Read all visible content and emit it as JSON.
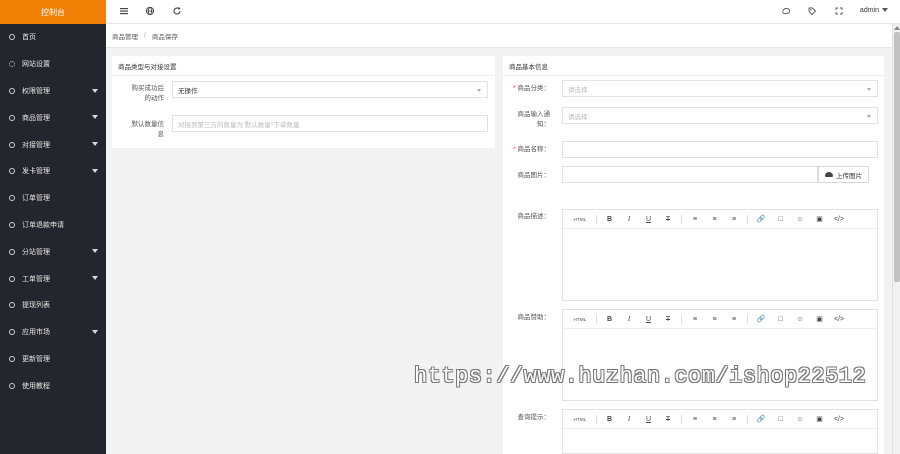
{
  "app": {
    "brand": "控制台",
    "admin": "admin"
  },
  "sidebar": {
    "items": [
      {
        "label": "首页",
        "icon": "circle-icon",
        "expandable": false
      },
      {
        "label": "网站设置",
        "icon": "gear-icon",
        "expandable": false
      },
      {
        "label": "权限管理",
        "icon": "circle-icon",
        "expandable": true
      },
      {
        "label": "商品管理",
        "icon": "circle-icon",
        "expandable": true
      },
      {
        "label": "对接管理",
        "icon": "circle-icon",
        "expandable": true
      },
      {
        "label": "发卡管理",
        "icon": "circle-icon",
        "expandable": true
      },
      {
        "label": "订单管理",
        "icon": "circle-icon",
        "expandable": false
      },
      {
        "label": "订单退款申请",
        "icon": "circle-icon",
        "expandable": false
      },
      {
        "label": "分站管理",
        "icon": "circle-icon",
        "expandable": true
      },
      {
        "label": "工单管理",
        "icon": "circle-icon",
        "expandable": true
      },
      {
        "label": "提现列表",
        "icon": "circle-icon",
        "expandable": false
      },
      {
        "label": "应用市场",
        "icon": "circle-icon",
        "expandable": true
      },
      {
        "label": "更新管理",
        "icon": "circle-icon",
        "expandable": false
      },
      {
        "label": "使用教程",
        "icon": "circle-icon",
        "expandable": false
      }
    ]
  },
  "topbar": {
    "left_icons": [
      "menu-icon",
      "globe-icon",
      "refresh-icon"
    ],
    "right_icons": [
      "theme-icon",
      "tag-icon",
      "fullscreen-icon"
    ]
  },
  "breadcrumb": {
    "items": [
      "商品管理",
      "商品保存"
    ],
    "separator": "/"
  },
  "left_card": {
    "title": "商品类型与对接设置",
    "action_label_line1": "购买成功后",
    "action_label_line2": "的动作",
    "action_value": "无操作",
    "default_qty_label_line1": "默认数量信",
    "default_qty_label_line2": "息",
    "default_qty_placeholder": "对接到第三方的数量为 默认数量*下单数量"
  },
  "right_card": {
    "title": "商品基本信息",
    "category_label": "商品分类：",
    "category_placeholder": "请选择",
    "group_label_line1": "商品输入通",
    "group_label_line2": "知：",
    "group_placeholder": "请选择",
    "name_label": "商品名称：",
    "image_label": "商品图片：",
    "upload_label": "上传图片",
    "desc_label": "商品描述：",
    "notes_label": "商品赞助：",
    "tips_label": "查询提示："
  },
  "editor_toolbar": {
    "html": "HTML",
    "bold": "B",
    "italic": "I",
    "underline": "U",
    "strike": "T",
    "align_left": "≡",
    "align_center": "≡",
    "align_right": "≡",
    "link": "🔗",
    "table": "□",
    "emoji": "☺",
    "image": "▣",
    "code": "</>"
  },
  "watermark": "https://www.huzhan.com/ishop22512",
  "colors": {
    "brand": "#f07f06",
    "sidebar": "#23262e",
    "required": "#e53935"
  }
}
